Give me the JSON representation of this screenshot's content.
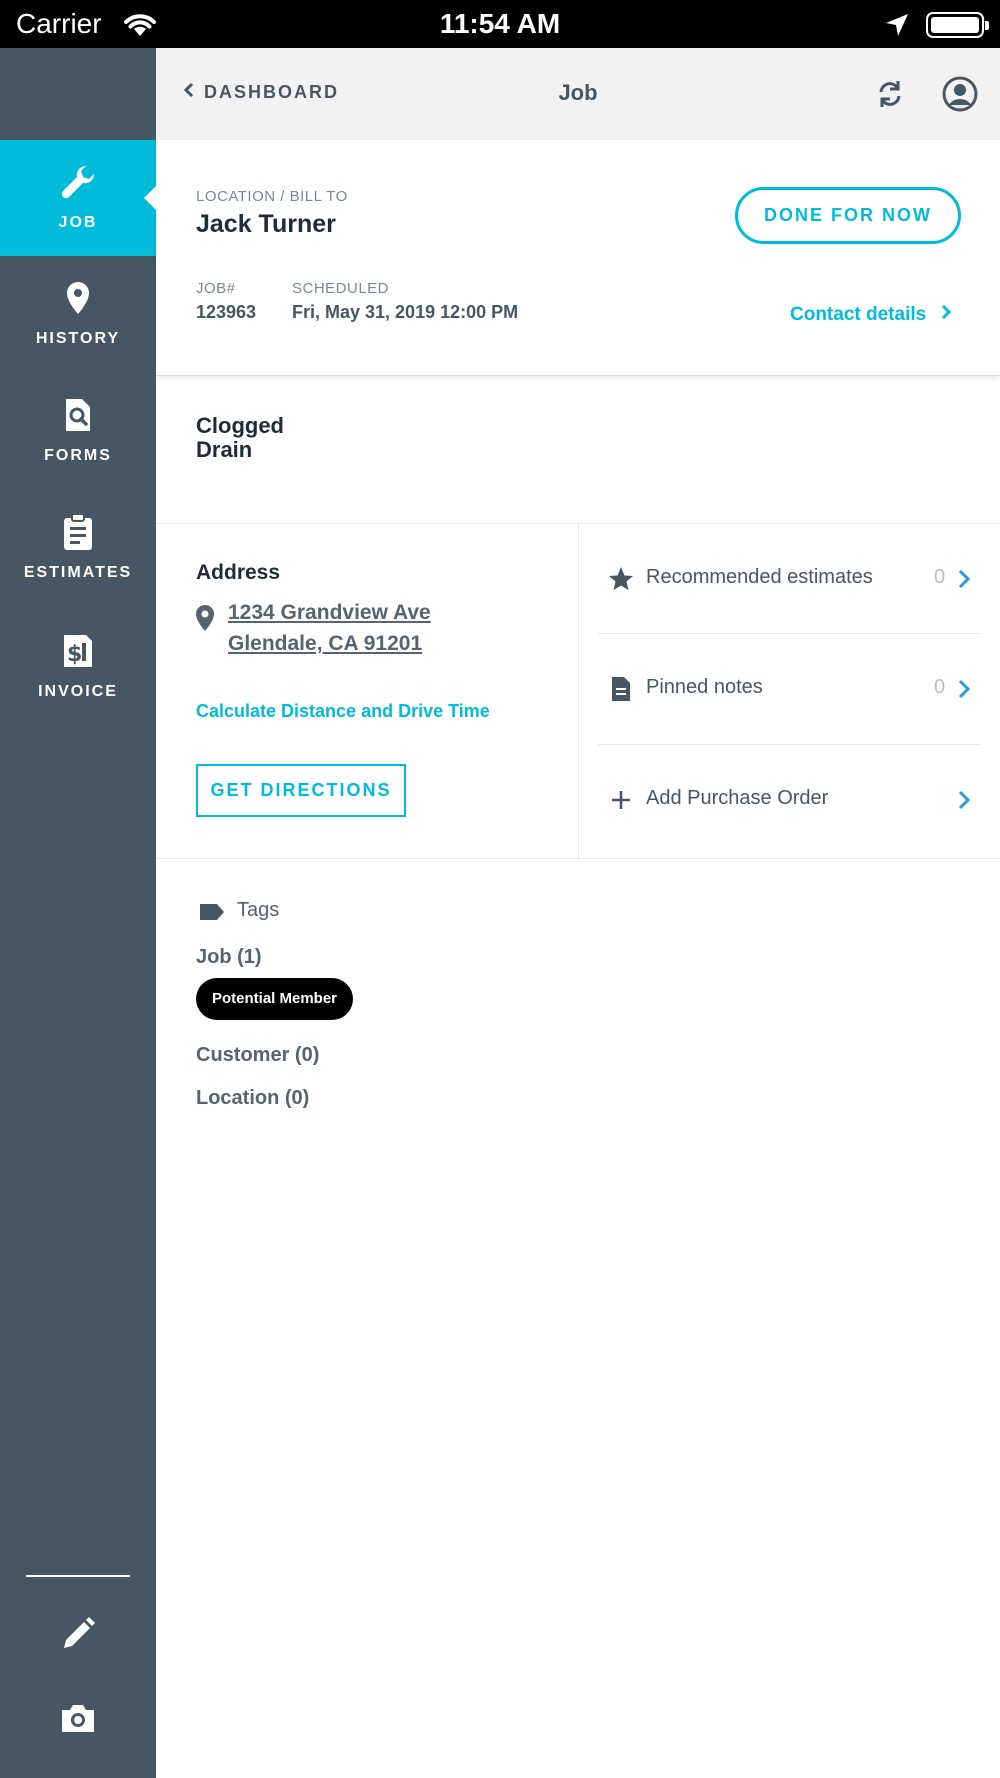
{
  "status_bar": {
    "carrier": "Carrier",
    "time": "11:54 AM"
  },
  "sidebar": {
    "items": [
      {
        "label": "JOB",
        "icon": "wrench-icon",
        "active": true
      },
      {
        "label": "HISTORY",
        "icon": "location-pin-icon",
        "active": false
      },
      {
        "label": "FORMS",
        "icon": "document-search-icon",
        "active": false
      },
      {
        "label": "ESTIMATES",
        "icon": "clipboard-icon",
        "active": false
      },
      {
        "label": "INVOICE",
        "icon": "invoice-dollar-icon",
        "active": false
      }
    ],
    "tools": [
      "pencil-icon",
      "camera-icon"
    ]
  },
  "header": {
    "back_label": "DASHBOARD",
    "title": "Job"
  },
  "job": {
    "location_label": "LOCATION / BILL TO",
    "customer_name": "Jack Turner",
    "job_number_label": "JOB#",
    "job_number": "123963",
    "scheduled_label": "SCHEDULED",
    "scheduled": "Fri, May 31, 2019 12:00 PM",
    "done_button": "DONE FOR NOW",
    "contact_link": "Contact details",
    "job_type_line1": "Clogged",
    "job_type_line2": "Drain"
  },
  "address": {
    "title": "Address",
    "line1": "1234 Grandview Ave",
    "line2": "Glendale, CA 91201",
    "calc_link": "Calculate Distance and Drive Time",
    "directions_button": "GET DIRECTIONS"
  },
  "side_list": [
    {
      "label": "Recommended estimates",
      "count": "0",
      "icon": "star-icon"
    },
    {
      "label": "Pinned notes",
      "count": "0",
      "icon": "note-icon"
    },
    {
      "label": "Add Purchase Order",
      "count": "",
      "icon": "plus-icon"
    }
  ],
  "tags": {
    "title": "Tags",
    "groups": [
      {
        "label": "Job (1)",
        "chips": [
          "Potential Member"
        ]
      },
      {
        "label": "Customer (0)",
        "chips": []
      },
      {
        "label": "Location (0)",
        "chips": []
      }
    ]
  },
  "colors": {
    "accent": "#00bcd9",
    "sidebar": "#465763",
    "header": "#f2f2f2",
    "chip": "#000000"
  }
}
